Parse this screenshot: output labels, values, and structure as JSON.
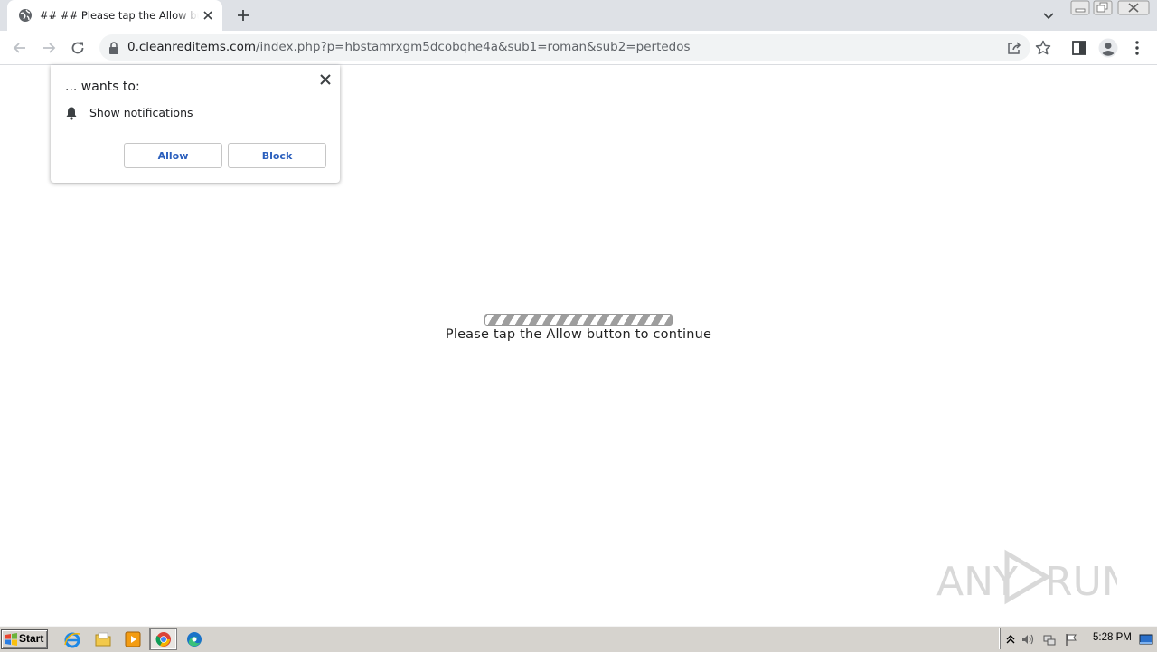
{
  "browser": {
    "tab": {
      "title": "## ## Please tap the Allow button to continue"
    },
    "address": {
      "host": "0.cleanreditems.com",
      "path": "/index.php?p=hbstamrxgm5dcobqhe4a&sub1=roman&sub2=pertedos"
    },
    "icons": {
      "back": "arrow-left-icon",
      "forward": "arrow-right-icon",
      "reload": "reload-icon",
      "lock": "lock-icon",
      "share": "share-icon",
      "bookmark": "star-icon",
      "side_panel": "side-panel-icon",
      "profile": "profile-icon",
      "menu": "kebab-menu-icon"
    }
  },
  "permission_prompt": {
    "origin_text": "... wants to:",
    "request": "Show notifications",
    "allow_label": "Allow",
    "block_label": "Block",
    "accent_color": "#2b5fbd"
  },
  "page": {
    "message": "Please tap the Allow button to continue"
  },
  "watermark": {
    "text": "ANY RUN"
  },
  "taskbar": {
    "start_label": "Start",
    "clock": "5:28 PM",
    "quick_launch": [
      "internet-explorer-icon",
      "folder-icon",
      "media-player-icon",
      "chrome-icon",
      "edge-icon"
    ]
  }
}
